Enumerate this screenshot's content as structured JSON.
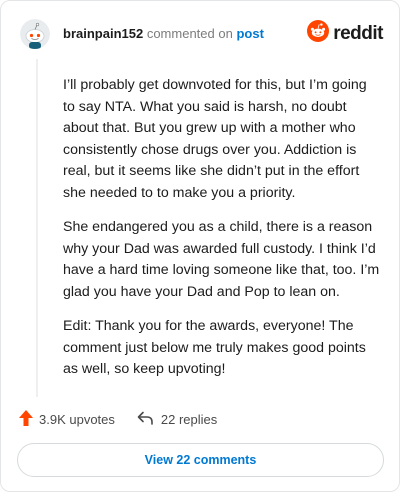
{
  "header": {
    "username": "brainpain152",
    "action_text": "commented on",
    "post_link": "post",
    "brand_text": "reddit"
  },
  "comment": {
    "paragraphs": [
      "I’ll probably get downvoted for this, but I’m going to say NTA. What you said is harsh, no doubt about that. But you grew up with a mother who consistently chose drugs over you. Addiction is real, but it seems like she didn’t put in the effort she needed to to make you a priority.",
      "She endangered you as a child, there is a reason why your Dad was awarded full custody. I think I’d have a hard time loving someone like that, too. I’m glad you have your Dad and Pop to lean on.",
      "Edit: Thank you for the awards, everyone! The comment just below me truly makes good points as well, so keep upvoting!"
    ]
  },
  "actions": {
    "upvotes": "3.9K upvotes",
    "replies": "22 replies"
  },
  "view_comments": "View 22 comments",
  "colors": {
    "reddit_orange": "#ff4500",
    "link_blue": "#0079d3",
    "upvote_arrow": "#ff4500"
  },
  "icons": {
    "avatar": "snoo-avatar-icon",
    "brand": "reddit-logo-icon",
    "upvote": "upvote-arrow-icon",
    "reply": "reply-arrow-icon"
  }
}
